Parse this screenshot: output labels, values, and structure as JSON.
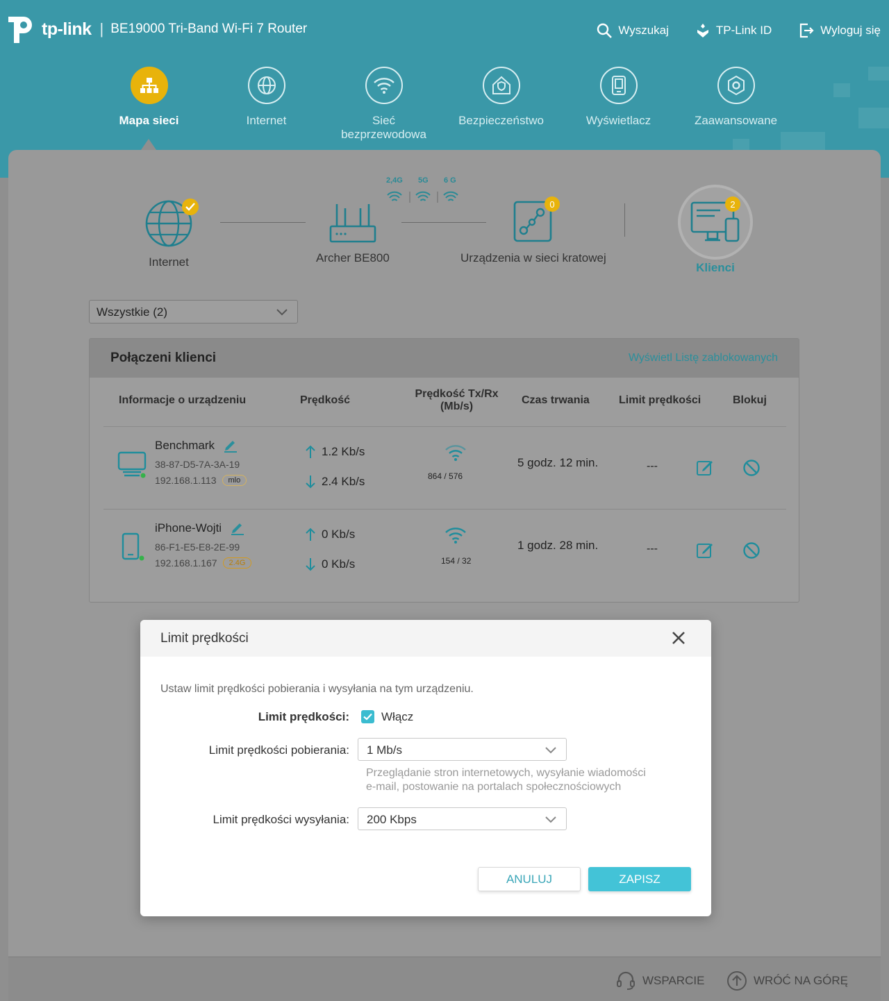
{
  "header": {
    "brand": "tp-link",
    "separator": "|",
    "model": "BE19000 Tri-Band Wi-Fi 7 Router",
    "search": "Wyszukaj",
    "tplink_id": "TP-Link ID",
    "logout": "Wyloguj się"
  },
  "nav": {
    "network_map": "Mapa sieci",
    "internet": "Internet",
    "wireless_line1": "Sieć",
    "wireless_line2": "bezprzewodowa",
    "security": "Bezpieczeństwo",
    "display": "Wyświetlacz",
    "advanced": "Zaawansowane"
  },
  "topology": {
    "internet": "Internet",
    "router": "Archer BE800",
    "mesh": "Urządzenia w sieci kratowej",
    "mesh_count": "0",
    "clients": "Klienci",
    "clients_count": "2",
    "band_24": "2,4G",
    "band_5": "5G",
    "band_6": "6 G"
  },
  "filter": {
    "value": "Wszystkie (2)"
  },
  "clients_table": {
    "title": "Połączeni klienci",
    "blocked_link": "Wyświetl Listę zablokowanych",
    "columns": {
      "device": "Informacje o urządzeniu",
      "speed": "Prędkość",
      "txrx_line1": "Prędkość Tx/Rx",
      "txrx_line2": "(Mb/s)",
      "duration": "Czas trwania",
      "limit": "Limit prędkości",
      "block": "Blokuj"
    },
    "rows": [
      {
        "name": "Benchmark",
        "mac": "38-87-D5-7A-3A-19",
        "ip": "192.168.1.113",
        "tag": "mlo",
        "up": "1.2 Kb/s",
        "down": "2.4 Kb/s",
        "txrx": "864 / 576",
        "duration": "5 godz. 12 min.",
        "limit": "---"
      },
      {
        "name": "iPhone-Wojti",
        "mac": "86-F1-E5-E8-2E-99",
        "ip": "192.168.1.167",
        "tag": "2.4G",
        "up": "0 Kb/s",
        "down": "0 Kb/s",
        "txrx": "154 / 32",
        "duration": "1 godz. 28 min.",
        "limit": "---"
      }
    ]
  },
  "modal": {
    "title": "Limit prędkości",
    "description": "Ustaw limit prędkości pobierania i wysyłania na tym urządzeniu.",
    "enable_label": "Limit prędkości:",
    "enable_option": "Włącz",
    "enabled": true,
    "download_label": "Limit prędkości pobierania:",
    "download_value": "1 Mb/s",
    "download_hint_line1": "Przeglądanie stron internetowych, wysyłanie wiadomości",
    "download_hint_line2": "e-mail, postowanie na portalach społecznościowych",
    "upload_label": "Limit prędkości wysyłania:",
    "upload_value": "200 Kbps",
    "cancel": "ANULUJ",
    "save": "ZAPISZ"
  },
  "footer": {
    "support": "WSPARCIE",
    "back_to_top": "WRÓĆ NA GÓRĘ"
  },
  "colors": {
    "header_bg": "#3a98a8",
    "accent": "#43c3d7",
    "badge": "#e8b30b",
    "link": "#2a8f9c"
  }
}
